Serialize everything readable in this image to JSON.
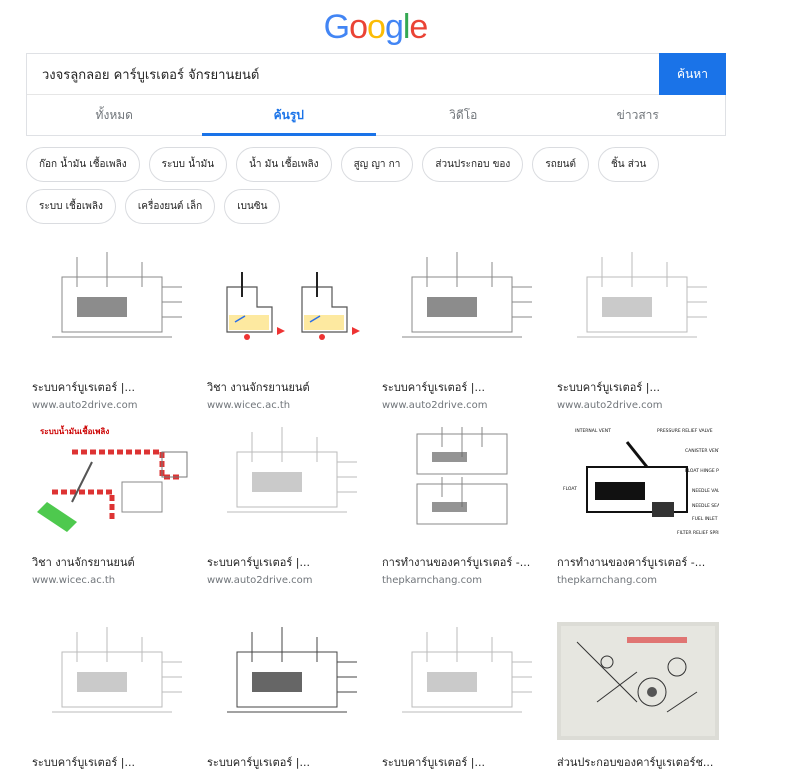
{
  "logo": {
    "letters": [
      "G",
      "o",
      "o",
      "g",
      "l",
      "e"
    ],
    "colors": [
      "#4285f4",
      "#ea4335",
      "#fbbc05",
      "#4285f4",
      "#34a853",
      "#ea4335"
    ]
  },
  "search": {
    "query": "วงจรลูกลอย คาร์บูเรเตอร์ จักรยานยนต์",
    "button_label": "ค้นหา"
  },
  "tabs": [
    {
      "label": "ทั้งหมด",
      "active": false
    },
    {
      "label": "ค้นรูป",
      "active": true
    },
    {
      "label": "วิดีโอ",
      "active": false
    },
    {
      "label": "ข่าวสาร",
      "active": false
    }
  ],
  "chips": [
    "ก๊อก น้ำมัน เชื้อเพลิง",
    "ระบบ น้ำมัน",
    "น้ำ มัน เชื้อเพลิง",
    "สูญ ญา กา",
    "ส่วนประกอบ ของ",
    "รถยนต์",
    "ชิ้น ส่วน",
    "ระบบ เชื้อเพลิง",
    "เครื่องยนต์ เล็ก",
    "เบนซิน"
  ],
  "results": [
    {
      "title": "ระบบคาร์บูเรเตอร์ |...",
      "site": "www.auto2drive.com",
      "style": "sketch"
    },
    {
      "title": "วิชา งานจักรยานยนต์",
      "site": "www.wicec.ac.th",
      "style": "color-pair"
    },
    {
      "title": "ระบบคาร์บูเรเตอร์ |...",
      "site": "www.auto2drive.com",
      "style": "sketch"
    },
    {
      "title": "ระบบคาร์บูเรเตอร์ |...",
      "site": "www.auto2drive.com",
      "style": "sketch-light"
    },
    {
      "title": "วิชา งานจักรยานยนต์",
      "site": "www.wicec.ac.th",
      "style": "color-red"
    },
    {
      "title": "ระบบคาร์บูเรเตอร์ |...",
      "site": "www.auto2drive.com",
      "style": "sketch-light"
    },
    {
      "title": "การทำงานของคาร์บูเรเตอร์ -...",
      "site": "thepkarnchang.com",
      "style": "sketch-double"
    },
    {
      "title": "การทำงานของคาร์บูเรเตอร์ -...",
      "site": "thepkarnchang.com",
      "style": "labeled"
    },
    {
      "title": "ระบบคาร์บูเรเตอร์ |...",
      "site": "",
      "style": "sketch-light"
    },
    {
      "title": "ระบบคาร์บูเรเตอร์ |...",
      "site": "",
      "style": "sketch-dark"
    },
    {
      "title": "ระบบคาร์บูเรเตอร์ |...",
      "site": "",
      "style": "sketch-light"
    },
    {
      "title": "ส่วนประกอบของคาร์บูเรเตอร์ช...",
      "site": "",
      "style": "photo"
    }
  ],
  "image_text": {
    "fuel_system_label": "ระบบน้ำมันเชื้อเพลิง",
    "labels": [
      "INTERNAL VENT",
      "PRESSURE RELIEF VALVE",
      "CANISTER VENT HOLE",
      "FLOAT HINGE PIN",
      "NEEDLE VALVE",
      "NEEDLE SEAT",
      "FUEL INLET FILTER",
      "FILTER RELIEF SPRING",
      "FLOAT"
    ]
  }
}
